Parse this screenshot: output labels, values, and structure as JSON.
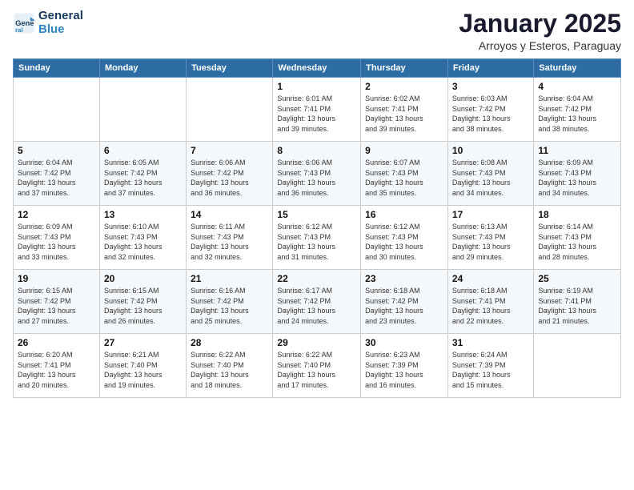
{
  "header": {
    "logo_line1": "General",
    "logo_line2": "Blue",
    "title": "January 2025",
    "subtitle": "Arroyos y Esteros, Paraguay"
  },
  "weekdays": [
    "Sunday",
    "Monday",
    "Tuesday",
    "Wednesday",
    "Thursday",
    "Friday",
    "Saturday"
  ],
  "weeks": [
    [
      {
        "day": "",
        "info": ""
      },
      {
        "day": "",
        "info": ""
      },
      {
        "day": "",
        "info": ""
      },
      {
        "day": "1",
        "info": "Sunrise: 6:01 AM\nSunset: 7:41 PM\nDaylight: 13 hours\nand 39 minutes."
      },
      {
        "day": "2",
        "info": "Sunrise: 6:02 AM\nSunset: 7:41 PM\nDaylight: 13 hours\nand 39 minutes."
      },
      {
        "day": "3",
        "info": "Sunrise: 6:03 AM\nSunset: 7:42 PM\nDaylight: 13 hours\nand 38 minutes."
      },
      {
        "day": "4",
        "info": "Sunrise: 6:04 AM\nSunset: 7:42 PM\nDaylight: 13 hours\nand 38 minutes."
      }
    ],
    [
      {
        "day": "5",
        "info": "Sunrise: 6:04 AM\nSunset: 7:42 PM\nDaylight: 13 hours\nand 37 minutes."
      },
      {
        "day": "6",
        "info": "Sunrise: 6:05 AM\nSunset: 7:42 PM\nDaylight: 13 hours\nand 37 minutes."
      },
      {
        "day": "7",
        "info": "Sunrise: 6:06 AM\nSunset: 7:42 PM\nDaylight: 13 hours\nand 36 minutes."
      },
      {
        "day": "8",
        "info": "Sunrise: 6:06 AM\nSunset: 7:43 PM\nDaylight: 13 hours\nand 36 minutes."
      },
      {
        "day": "9",
        "info": "Sunrise: 6:07 AM\nSunset: 7:43 PM\nDaylight: 13 hours\nand 35 minutes."
      },
      {
        "day": "10",
        "info": "Sunrise: 6:08 AM\nSunset: 7:43 PM\nDaylight: 13 hours\nand 34 minutes."
      },
      {
        "day": "11",
        "info": "Sunrise: 6:09 AM\nSunset: 7:43 PM\nDaylight: 13 hours\nand 34 minutes."
      }
    ],
    [
      {
        "day": "12",
        "info": "Sunrise: 6:09 AM\nSunset: 7:43 PM\nDaylight: 13 hours\nand 33 minutes."
      },
      {
        "day": "13",
        "info": "Sunrise: 6:10 AM\nSunset: 7:43 PM\nDaylight: 13 hours\nand 32 minutes."
      },
      {
        "day": "14",
        "info": "Sunrise: 6:11 AM\nSunset: 7:43 PM\nDaylight: 13 hours\nand 32 minutes."
      },
      {
        "day": "15",
        "info": "Sunrise: 6:12 AM\nSunset: 7:43 PM\nDaylight: 13 hours\nand 31 minutes."
      },
      {
        "day": "16",
        "info": "Sunrise: 6:12 AM\nSunset: 7:43 PM\nDaylight: 13 hours\nand 30 minutes."
      },
      {
        "day": "17",
        "info": "Sunrise: 6:13 AM\nSunset: 7:43 PM\nDaylight: 13 hours\nand 29 minutes."
      },
      {
        "day": "18",
        "info": "Sunrise: 6:14 AM\nSunset: 7:43 PM\nDaylight: 13 hours\nand 28 minutes."
      }
    ],
    [
      {
        "day": "19",
        "info": "Sunrise: 6:15 AM\nSunset: 7:42 PM\nDaylight: 13 hours\nand 27 minutes."
      },
      {
        "day": "20",
        "info": "Sunrise: 6:15 AM\nSunset: 7:42 PM\nDaylight: 13 hours\nand 26 minutes."
      },
      {
        "day": "21",
        "info": "Sunrise: 6:16 AM\nSunset: 7:42 PM\nDaylight: 13 hours\nand 25 minutes."
      },
      {
        "day": "22",
        "info": "Sunrise: 6:17 AM\nSunset: 7:42 PM\nDaylight: 13 hours\nand 24 minutes."
      },
      {
        "day": "23",
        "info": "Sunrise: 6:18 AM\nSunset: 7:42 PM\nDaylight: 13 hours\nand 23 minutes."
      },
      {
        "day": "24",
        "info": "Sunrise: 6:18 AM\nSunset: 7:41 PM\nDaylight: 13 hours\nand 22 minutes."
      },
      {
        "day": "25",
        "info": "Sunrise: 6:19 AM\nSunset: 7:41 PM\nDaylight: 13 hours\nand 21 minutes."
      }
    ],
    [
      {
        "day": "26",
        "info": "Sunrise: 6:20 AM\nSunset: 7:41 PM\nDaylight: 13 hours\nand 20 minutes."
      },
      {
        "day": "27",
        "info": "Sunrise: 6:21 AM\nSunset: 7:40 PM\nDaylight: 13 hours\nand 19 minutes."
      },
      {
        "day": "28",
        "info": "Sunrise: 6:22 AM\nSunset: 7:40 PM\nDaylight: 13 hours\nand 18 minutes."
      },
      {
        "day": "29",
        "info": "Sunrise: 6:22 AM\nSunset: 7:40 PM\nDaylight: 13 hours\nand 17 minutes."
      },
      {
        "day": "30",
        "info": "Sunrise: 6:23 AM\nSunset: 7:39 PM\nDaylight: 13 hours\nand 16 minutes."
      },
      {
        "day": "31",
        "info": "Sunrise: 6:24 AM\nSunset: 7:39 PM\nDaylight: 13 hours\nand 15 minutes."
      },
      {
        "day": "",
        "info": ""
      }
    ]
  ]
}
